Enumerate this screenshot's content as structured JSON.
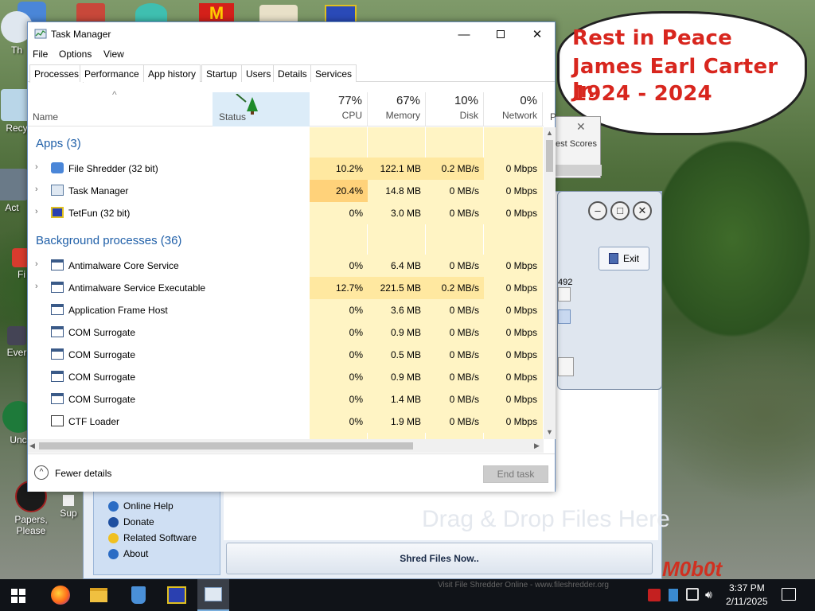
{
  "desktop": {
    "icons": [
      {
        "label": "Th"
      },
      {
        "label": "Recy"
      },
      {
        "label": "Act"
      },
      {
        "label": "Fi"
      },
      {
        "label": "Ever"
      },
      {
        "label": "Unc"
      },
      {
        "label": "Papers, Please"
      },
      {
        "label": "Sup"
      }
    ],
    "memorial": {
      "line1": "Rest in Peace",
      "line2": "James Earl Carter Jr.",
      "line3": "1924 - 2024"
    }
  },
  "shredder": {
    "drag_hint": "Drag & Drop Files Here",
    "shred_button": "Shred Files Now..",
    "side_links": [
      "Online Help",
      "Donate",
      "Related Software",
      "About"
    ],
    "exit_button": "Exit",
    "partial_value": "492",
    "partial_scores": "est Scores",
    "footer_text": "Visit File Shredder Online - www.fileshredder.org"
  },
  "task_manager": {
    "title": "Task Manager",
    "menu": [
      "File",
      "Options",
      "View"
    ],
    "tabs": [
      "Processes",
      "Performance",
      "App history",
      "Startup",
      "Users",
      "Details",
      "Services"
    ],
    "active_tab": "Processes",
    "columns": {
      "name": "Name",
      "status": "Status",
      "cpu_pct": "77%",
      "cpu": "CPU",
      "memory_pct": "67%",
      "memory": "Memory",
      "disk_pct": "10%",
      "disk": "Disk",
      "network_pct": "0%",
      "network": "Network",
      "power_partial": "P"
    },
    "groups": {
      "apps": "Apps (3)",
      "background": "Background processes (36)"
    },
    "apps": [
      {
        "name": "File Shredder (32 bit)",
        "cpu": "10.2%",
        "memory": "122.1 MB",
        "disk": "0.2 MB/s",
        "network": "0 Mbps",
        "expandable": true
      },
      {
        "name": "Task Manager",
        "cpu": "20.4%",
        "memory": "14.8 MB",
        "disk": "0 MB/s",
        "network": "0 Mbps",
        "expandable": true
      },
      {
        "name": "TetFun (32 bit)",
        "cpu": "0%",
        "memory": "3.0 MB",
        "disk": "0 MB/s",
        "network": "0 Mbps",
        "expandable": true
      }
    ],
    "background": [
      {
        "name": "Antimalware Core Service",
        "cpu": "0%",
        "memory": "6.4 MB",
        "disk": "0 MB/s",
        "network": "0 Mbps",
        "expandable": true
      },
      {
        "name": "Antimalware Service Executable",
        "cpu": "12.7%",
        "memory": "221.5 MB",
        "disk": "0.2 MB/s",
        "network": "0 Mbps",
        "expandable": true
      },
      {
        "name": "Application Frame Host",
        "cpu": "0%",
        "memory": "3.6 MB",
        "disk": "0 MB/s",
        "network": "0 Mbps",
        "expandable": false
      },
      {
        "name": "COM Surrogate",
        "cpu": "0%",
        "memory": "0.9 MB",
        "disk": "0 MB/s",
        "network": "0 Mbps",
        "expandable": false
      },
      {
        "name": "COM Surrogate",
        "cpu": "0%",
        "memory": "0.5 MB",
        "disk": "0 MB/s",
        "network": "0 Mbps",
        "expandable": false
      },
      {
        "name": "COM Surrogate",
        "cpu": "0%",
        "memory": "0.9 MB",
        "disk": "0 MB/s",
        "network": "0 Mbps",
        "expandable": false
      },
      {
        "name": "COM Surrogate",
        "cpu": "0%",
        "memory": "1.4 MB",
        "disk": "0 MB/s",
        "network": "0 Mbps",
        "expandable": false
      },
      {
        "name": "CTF Loader",
        "cpu": "0%",
        "memory": "1.9 MB",
        "disk": "0 MB/s",
        "network": "0 Mbps",
        "expandable": false
      }
    ],
    "fewer_details": "Fewer details",
    "end_task": "End task"
  },
  "taskbar": {
    "time": "3:37 PM",
    "date": "2/11/2025"
  },
  "colors": {
    "heat_light": "#fff4c4",
    "heat_mid": "#ffe8a0",
    "heat_high": "#ffd27a",
    "group_blue": "#1f5fa8",
    "memorial_red": "#d8261e",
    "taskbar": "#101318"
  }
}
